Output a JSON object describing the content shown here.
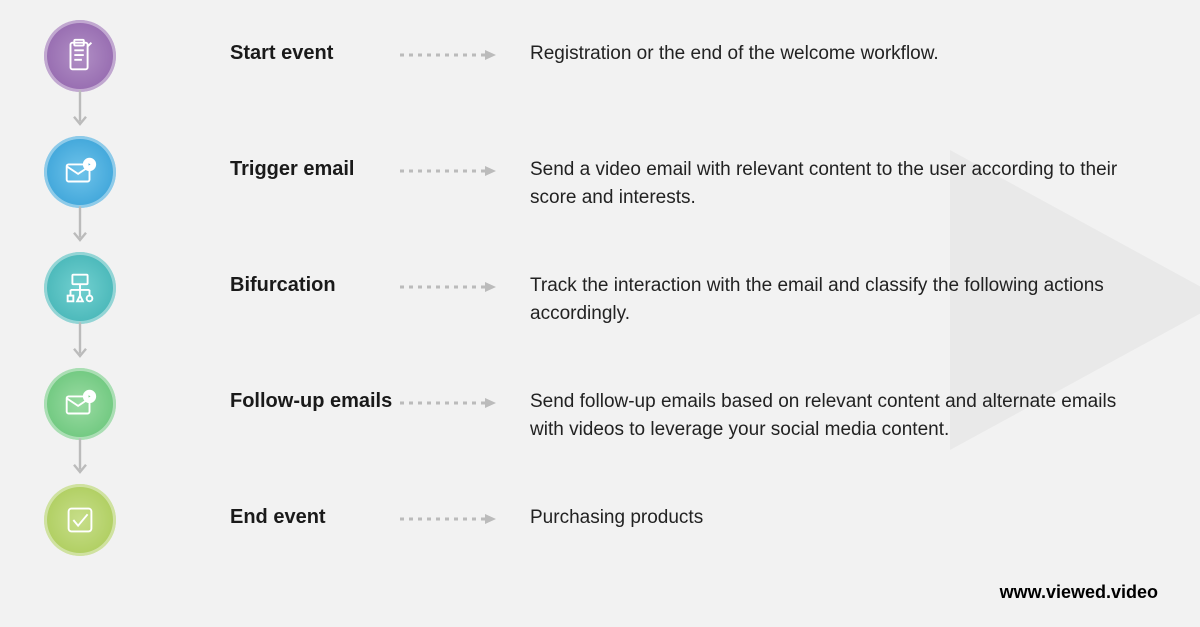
{
  "steps": [
    {
      "label": "Start event",
      "desc": "Registration or the end of the welcome workflow.",
      "color": "#9c6fb8",
      "icon": "clipboard"
    },
    {
      "label": "Trigger email",
      "desc": "Send a video email with relevant content to the user according to their score and interests.",
      "color": "#4ab1e0",
      "icon": "email-play"
    },
    {
      "label": "Bifurcation",
      "desc": "Track the interaction with the email and classify the following actions accordingly.",
      "color": "#4fc3c3",
      "icon": "branch"
    },
    {
      "label": "Follow-up emails",
      "desc": "Send follow-up emails based on relevant content and alternate emails with videos to leverage your social media content.",
      "color": "#7dd08a",
      "icon": "email-play"
    },
    {
      "label": "End event",
      "desc": "Purchasing products",
      "color": "#b6d468",
      "icon": "check"
    }
  ],
  "footer": "www.viewed.video"
}
